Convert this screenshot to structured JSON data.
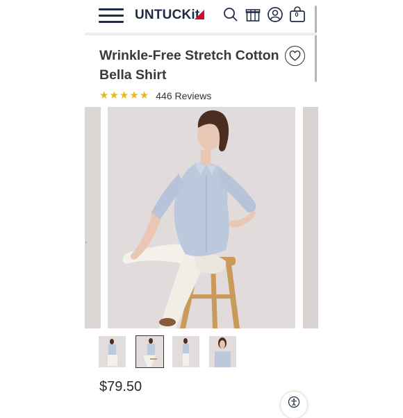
{
  "header": {
    "menu_icon": "hamburger-menu-icon",
    "logo_text": "UNTUCKit",
    "logo_colors": {
      "text": "#1f2a44",
      "mark": "#c8102e"
    },
    "icons": [
      "search-icon",
      "gift-icon",
      "account-icon",
      "cart-icon"
    ],
    "cart_count": "0"
  },
  "product": {
    "title": "Wrinkle-Free Stretch Cotton Bella Shirt",
    "favorite_icon": "heart-icon",
    "rating": {
      "stars": 5,
      "reviews_label": "446 Reviews"
    },
    "price": "$79.50"
  },
  "gallery": {
    "thumbnail_count": 4,
    "active_thumbnail": 2
  },
  "colors": {
    "star": "#e8b913",
    "shirt": "#bcc8dc",
    "pants": "#f4f1ea",
    "background": "#e1dcdb"
  }
}
